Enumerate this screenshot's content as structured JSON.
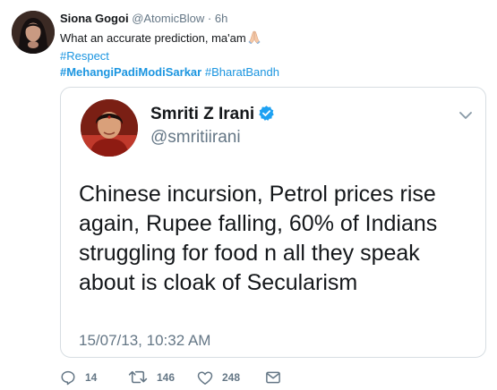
{
  "tweet": {
    "author_name": "Siona Gogoi",
    "author_handle": "@AtomicBlow",
    "separator": "·",
    "time": "6h",
    "text": "What an accurate prediction, ma'am",
    "emoji": "folded-hands",
    "hashtags": [
      "#Respect",
      "#MehangiPadiModiSarkar",
      "#BharatBandh"
    ]
  },
  "quoted_tweet": {
    "author_name": "Smriti Z Irani",
    "verified": true,
    "author_handle": "@smritiirani",
    "text_lines": [
      "Chinese incursion, Petrol prices rise",
      "again, Rupee falling, 60% of Indians",
      "struggling for food n all they speak",
      "about is cloak of Secularism"
    ],
    "timestamp": "15/07/13, 10:32 AM"
  },
  "actions": {
    "reply_count": "14",
    "retweet_count": "146",
    "like_count": "248"
  },
  "colors": {
    "link": "#1b95e0",
    "secondary_text": "#657786",
    "card_border": "#d7dde2",
    "verified": "#1da1f2"
  }
}
